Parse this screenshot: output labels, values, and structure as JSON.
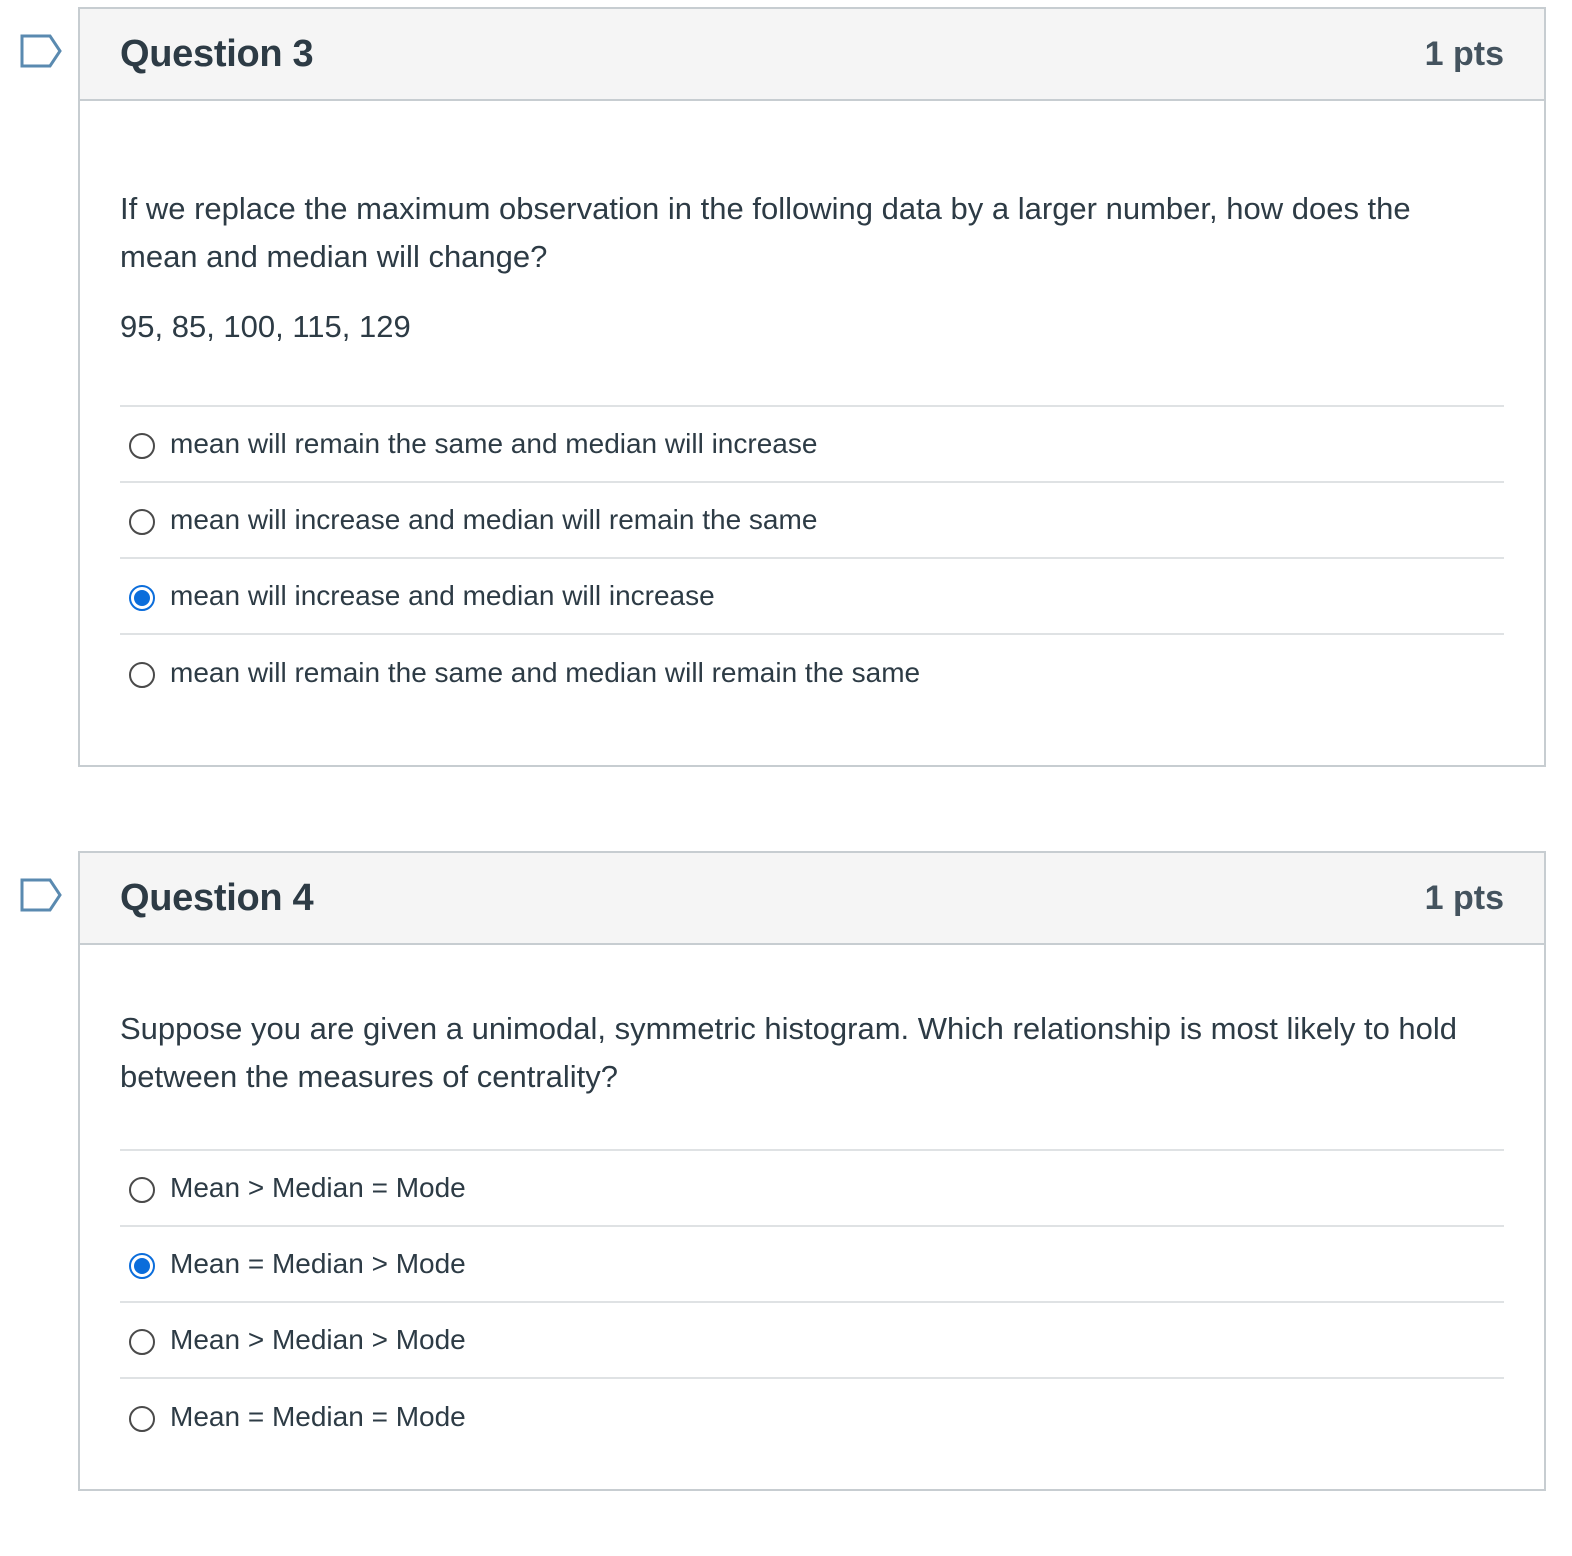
{
  "questions": [
    {
      "title": "Question 3",
      "points": "1 pts",
      "text": "If we replace the maximum observation in the following data by a larger number, how does the mean and median will change?",
      "data": "95, 85, 100, 115, 129",
      "answers": [
        {
          "label": "mean will remain the same and median will increase",
          "selected": false
        },
        {
          "label": "mean will increase and median will remain the same",
          "selected": false
        },
        {
          "label": "mean will increase and median will increase",
          "selected": true
        },
        {
          "label": "mean will remain the same and median will remain the same",
          "selected": false
        }
      ]
    },
    {
      "title": "Question 4",
      "points": "1 pts",
      "text": "Suppose you are given a unimodal, symmetric histogram. Which relationship is most likely to hold between the measures of centrality?",
      "answers": [
        {
          "label": "Mean > Median = Mode",
          "selected": false
        },
        {
          "label": "Mean = Median > Mode",
          "selected": true
        },
        {
          "label": "Mean > Median > Mode",
          "selected": false
        },
        {
          "label": "Mean = Median = Mode",
          "selected": false
        }
      ]
    }
  ],
  "icons": {
    "flag": "flag-icon",
    "radio": "radio-button",
    "accent_color": "#0b6ddb"
  }
}
